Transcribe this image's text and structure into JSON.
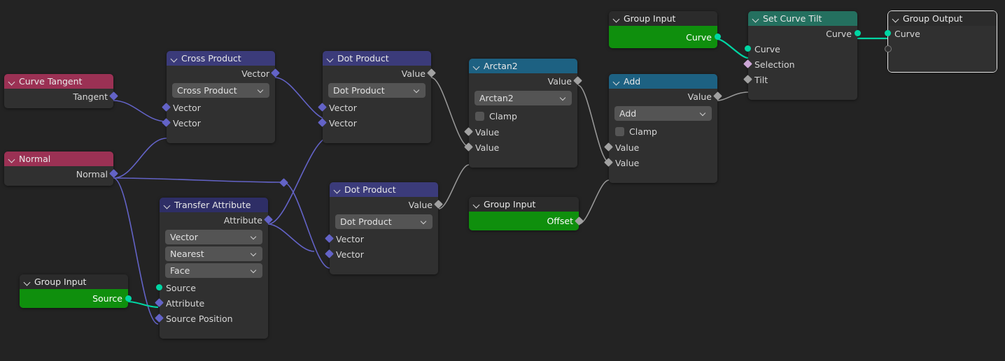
{
  "editor": {
    "name": "Blender Geometry Node Editor",
    "background_color": "#232323"
  },
  "colors": {
    "header_input": "#9b3154",
    "header_vector": "#3b3b7a",
    "header_converter": "#1d6182",
    "header_geometry": "#24705f",
    "header_group": "#2b2b2b",
    "band_green": "#0f8f0d",
    "socket_vector": "#6363c7",
    "socket_value": "#a1a1a1",
    "socket_geometry": "#00d6a3",
    "socket_boolean": "#cca6d6",
    "link_vector": "#6363c7",
    "link_value": "#9a9a9a",
    "link_geometry": "#00d6a3"
  },
  "nodes": {
    "curve_tangent": {
      "title": "Curve Tangent",
      "outputs": [
        {
          "label": "Tangent",
          "type": "vector"
        }
      ]
    },
    "normal": {
      "title": "Normal",
      "outputs": [
        {
          "label": "Normal",
          "type": "vector"
        }
      ]
    },
    "group_input_source": {
      "title": "Group Input",
      "outputs": [
        {
          "label": "Source",
          "type": "geometry"
        }
      ]
    },
    "cross_product": {
      "title": "Cross Product",
      "outputs": [
        {
          "label": "Vector",
          "type": "vector"
        }
      ],
      "operation": "Cross Product",
      "inputs": [
        {
          "label": "Vector",
          "type": "vector"
        },
        {
          "label": "Vector",
          "type": "vector"
        }
      ]
    },
    "transfer_attribute": {
      "title": "Transfer Attribute",
      "outputs": [
        {
          "label": "Attribute",
          "type": "vector"
        }
      ],
      "data_type": "Vector",
      "mapping": "Nearest",
      "domain": "Face",
      "inputs": [
        {
          "label": "Source",
          "type": "geometry"
        },
        {
          "label": "Attribute",
          "type": "vector"
        },
        {
          "label": "Source Position",
          "type": "vector"
        }
      ]
    },
    "dot_product_top": {
      "title": "Dot Product",
      "outputs": [
        {
          "label": "Value",
          "type": "value"
        }
      ],
      "operation": "Dot Product",
      "inputs": [
        {
          "label": "Vector",
          "type": "vector"
        },
        {
          "label": "Vector",
          "type": "vector"
        }
      ]
    },
    "dot_product_bottom": {
      "title": "Dot Product",
      "outputs": [
        {
          "label": "Value",
          "type": "value"
        }
      ],
      "operation": "Dot Product",
      "inputs": [
        {
          "label": "Vector",
          "type": "vector"
        },
        {
          "label": "Vector",
          "type": "vector"
        }
      ]
    },
    "arctan2": {
      "title": "Arctan2",
      "outputs": [
        {
          "label": "Value",
          "type": "value"
        }
      ],
      "operation": "Arctan2",
      "clamp_label": "Clamp",
      "clamp_checked": false,
      "inputs": [
        {
          "label": "Value",
          "type": "value"
        },
        {
          "label": "Value",
          "type": "value"
        }
      ]
    },
    "group_input_offset": {
      "title": "Group Input",
      "outputs": [
        {
          "label": "Offset",
          "type": "value"
        }
      ]
    },
    "group_input_curve": {
      "title": "Group Input",
      "outputs": [
        {
          "label": "Curve",
          "type": "geometry"
        }
      ]
    },
    "add": {
      "title": "Add",
      "outputs": [
        {
          "label": "Value",
          "type": "value"
        }
      ],
      "operation": "Add",
      "clamp_label": "Clamp",
      "clamp_checked": false,
      "inputs": [
        {
          "label": "Value",
          "type": "value"
        },
        {
          "label": "Value",
          "type": "value"
        }
      ]
    },
    "set_curve_tilt": {
      "title": "Set Curve Tilt",
      "outputs": [
        {
          "label": "Curve",
          "type": "geometry"
        }
      ],
      "inputs": [
        {
          "label": "Curve",
          "type": "geometry"
        },
        {
          "label": "Selection",
          "type": "boolean"
        },
        {
          "label": "Tilt",
          "type": "value"
        }
      ]
    },
    "group_output": {
      "title": "Group Output",
      "inputs": [
        {
          "label": "Curve",
          "type": "geometry"
        },
        {
          "label": "",
          "type": "empty"
        }
      ]
    }
  }
}
